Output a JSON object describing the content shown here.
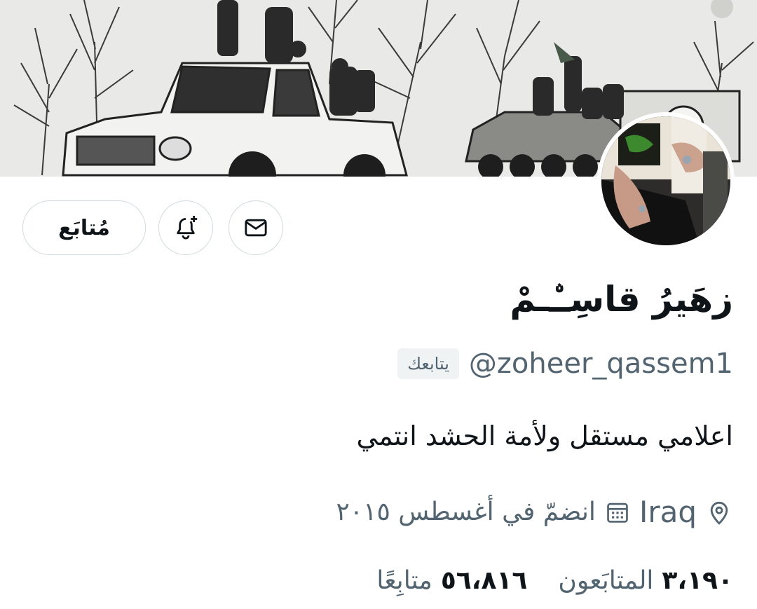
{
  "profile": {
    "display_name": "زهَيرُ قاسِـۨـمْ",
    "handle": "@zoheer_qassem1",
    "follows_you_badge": "يتابعك",
    "bio": "اعلامي مستقل ولأمة الحشد انتمي",
    "location": "Iraq",
    "joined": "انضمّ في أغسطس ٢٠١٥"
  },
  "actions": {
    "follow_label": "مُتابَع",
    "bell_icon": "bell-plus-icon",
    "mail_icon": "envelope-icon"
  },
  "stats": {
    "followers_count": "٣،١٩٠",
    "followers_label": "المتابَعون",
    "following_count": "٥٦،٨١٦",
    "following_label": "متابِعًا"
  },
  "icons": {
    "location": "map-pin-icon",
    "calendar": "calendar-icon"
  },
  "colors": {
    "text_primary": "#0f1419",
    "text_secondary": "#536471",
    "border": "#cfd9de",
    "badge_bg": "#eff3f4"
  }
}
